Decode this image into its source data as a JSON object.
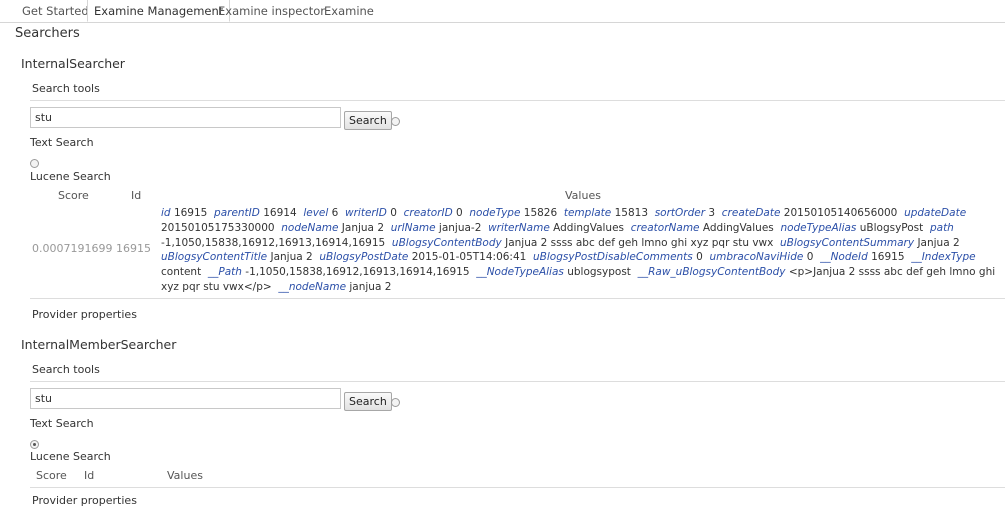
{
  "tabs": [
    {
      "label": "Get Started"
    },
    {
      "label": "Examine Management"
    },
    {
      "label": "Examine inspector"
    },
    {
      "label": "Examine"
    }
  ],
  "section_title": "Searchers",
  "searchers": [
    {
      "name": "InternalSearcher",
      "search_tools_label": "Search tools",
      "query": "stu",
      "search_button": "Search",
      "text_search_label": "Text Search",
      "lucene_search_label": "Lucene Search",
      "lucene_selected": false,
      "columns": {
        "score": "Score",
        "id": "Id",
        "values": "Values"
      },
      "result": {
        "score": "0.0007191699",
        "id": "16915",
        "fields": [
          {
            "k": "id",
            "v": "16915"
          },
          {
            "k": "parentID",
            "v": "16914"
          },
          {
            "k": "level",
            "v": "6"
          },
          {
            "k": "writerID",
            "v": "0"
          },
          {
            "k": "creatorID",
            "v": "0"
          },
          {
            "k": "nodeType",
            "v": "15826"
          },
          {
            "k": "template",
            "v": "15813"
          },
          {
            "k": "sortOrder",
            "v": "3"
          },
          {
            "k": "createDate",
            "v": "20150105140656000"
          },
          {
            "k": "updateDate",
            "v": "20150105175330000"
          },
          {
            "k": "nodeName",
            "v": "Janjua 2"
          },
          {
            "k": "urlName",
            "v": "janjua-2"
          },
          {
            "k": "writerName",
            "v": "AddingValues"
          },
          {
            "k": "creatorName",
            "v": "AddingValues"
          },
          {
            "k": "nodeTypeAlias",
            "v": "uBlogsyPost"
          },
          {
            "k": "path",
            "v": "-1,1050,15838,16912,16913,16914,16915"
          },
          {
            "k": "uBlogsyContentBody",
            "v": "Janjua 2 ssss abc def geh lmno ghi xyz pqr stu vwx"
          },
          {
            "k": "uBlogsyContentSummary",
            "v": "Janjua 2"
          },
          {
            "k": "uBlogsyContentTitle",
            "v": "Janjua 2"
          },
          {
            "k": "uBlogsyPostDate",
            "v": "2015-01-05T14:06:41"
          },
          {
            "k": "uBlogsyPostDisableComments",
            "v": "0"
          },
          {
            "k": "umbracoNaviHide",
            "v": "0"
          },
          {
            "k": "__NodeId",
            "v": "16915"
          },
          {
            "k": "__IndexType",
            "v": "content"
          },
          {
            "k": "__Path",
            "v": "-1,1050,15838,16912,16913,16914,16915"
          },
          {
            "k": "__NodeTypeAlias",
            "v": "ublogsypost"
          },
          {
            "k": "__Raw_uBlogsyContentBody",
            "v": "<p>Janjua 2 ssss abc def geh lmno ghi xyz pqr stu vwx</p>"
          },
          {
            "k": "__nodeName",
            "v": "janjua 2"
          }
        ]
      },
      "provider_properties_label": "Provider properties"
    },
    {
      "name": "InternalMemberSearcher",
      "search_tools_label": "Search tools",
      "query": "stu",
      "search_button": "Search",
      "text_search_label": "Text Search",
      "lucene_search_label": "Lucene Search",
      "lucene_selected": true,
      "columns": {
        "score": "Score",
        "id": "Id",
        "values": "Values"
      },
      "provider_properties_label": "Provider properties"
    }
  ],
  "colors": {
    "field_key": "#2b4fa8",
    "muted": "#999999",
    "border": "#d6d6d6"
  }
}
